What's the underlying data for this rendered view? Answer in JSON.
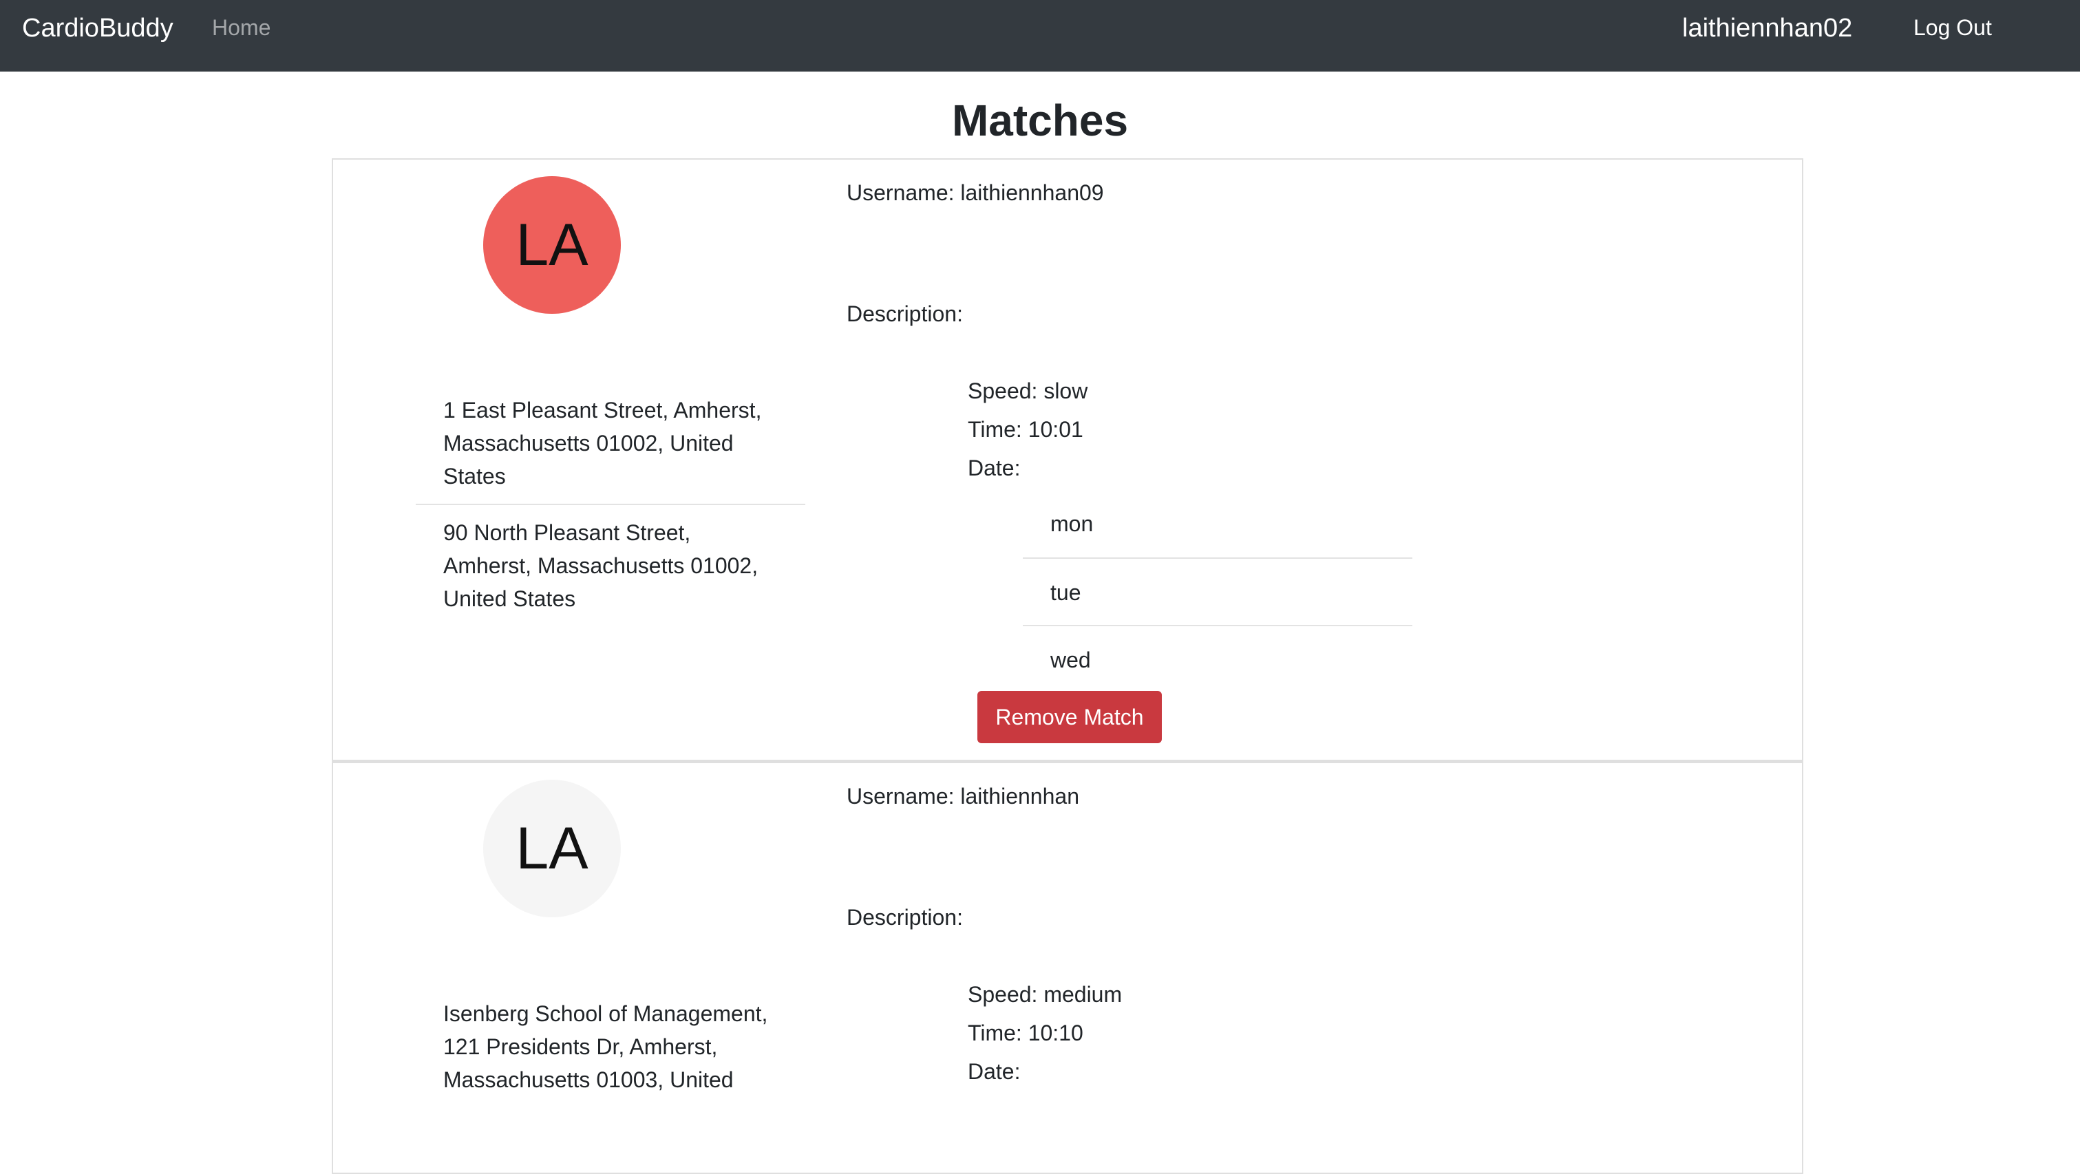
{
  "nav": {
    "brand": "CardioBuddy",
    "home": "Home",
    "username": "laithiennhan02",
    "logout": "Log Out"
  },
  "page": {
    "title": "Matches"
  },
  "matches": [
    {
      "initials": "LA",
      "avatar_color": "#ee5f5b",
      "addresses": [
        "1 East Pleasant Street, Amherst, Massachusetts 01002, United States",
        "90 North Pleasant Street, Amherst, Massachusetts 01002, United States"
      ],
      "username": "Username: laithiennhan09",
      "description": "Description:",
      "speed": "Speed: slow",
      "time": "Time: 10:01",
      "date_label": "Date:",
      "dates": [
        "mon",
        "tue",
        "wed"
      ],
      "remove_label": "Remove Match"
    },
    {
      "initials": "LA",
      "avatar_color": "#f5f5f5",
      "addresses": [
        "Isenberg School of Management, 121 Presidents Dr, Amherst, Massachusetts 01003, United"
      ],
      "username": "Username: laithiennhan",
      "description": "Description:",
      "speed": "Speed: medium",
      "time": "Time: 10:10",
      "date_label": "Date:"
    }
  ]
}
